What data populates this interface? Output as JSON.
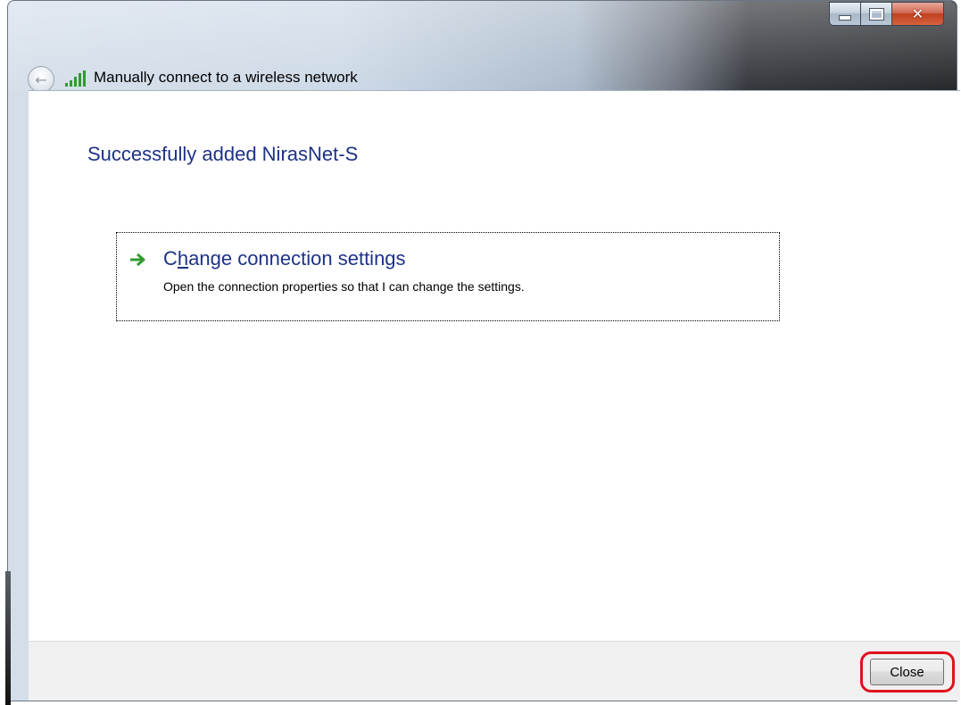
{
  "window": {
    "title": "Manually connect to a wireless network",
    "caption_buttons": [
      "minimize",
      "maximize",
      "close"
    ]
  },
  "content": {
    "heading": "Successfully added NirasNet-S",
    "option": {
      "title_prefix": "C",
      "title_underline": "h",
      "title_rest": "ange connection settings",
      "description": "Open the connection properties so that I can change the settings."
    }
  },
  "footer": {
    "close_label": "Close"
  },
  "colors": {
    "heading_blue": "#1e3287",
    "arrow_green": "#2f9b2f",
    "annotation_red": "#e0121d"
  },
  "icons": {
    "back": "back-arrow-icon",
    "signal": "wireless-signal-icon",
    "option_arrow": "green-arrow-icon"
  }
}
